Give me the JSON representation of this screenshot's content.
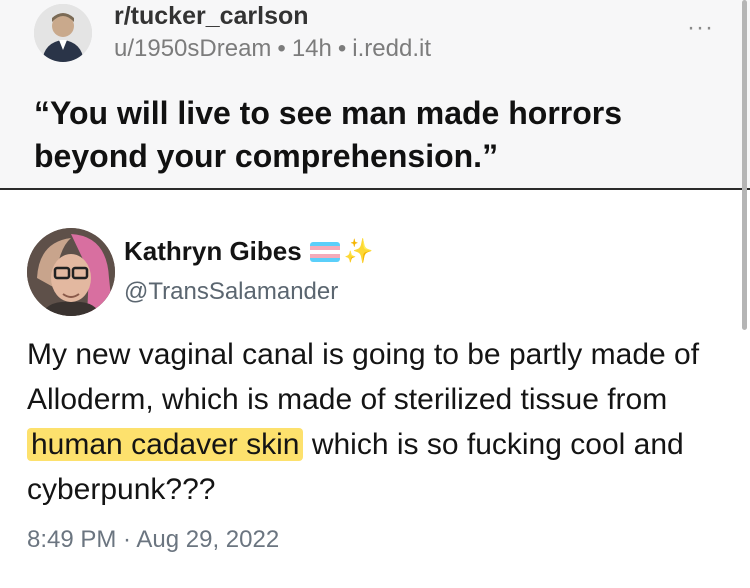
{
  "post": {
    "subreddit": "r/tucker_carlson",
    "author": "u/1950sDream",
    "age": "14h",
    "domain": "i.redd.it",
    "more_label": "···",
    "title": "“You will live to see man made horrors beyond your comprehension.”"
  },
  "tweet": {
    "display_name": "Kathryn Gibes",
    "sparkle": "✨",
    "handle": "@TransSalamander",
    "text_before": "My new vaginal canal is going to be partly made of Alloderm, which is made of sterilized tissue from ",
    "text_highlight": "human cadaver skin",
    "text_after": " which is so fucking cool and cyberpunk???",
    "timestamp": "8:49 PM · Aug 29, 2022"
  },
  "colors": {
    "highlight": "#fde16d",
    "flag_stripes": [
      "#5bcffa",
      "#f5abb9",
      "#ffffff",
      "#f5abb9",
      "#5bcffa"
    ]
  }
}
